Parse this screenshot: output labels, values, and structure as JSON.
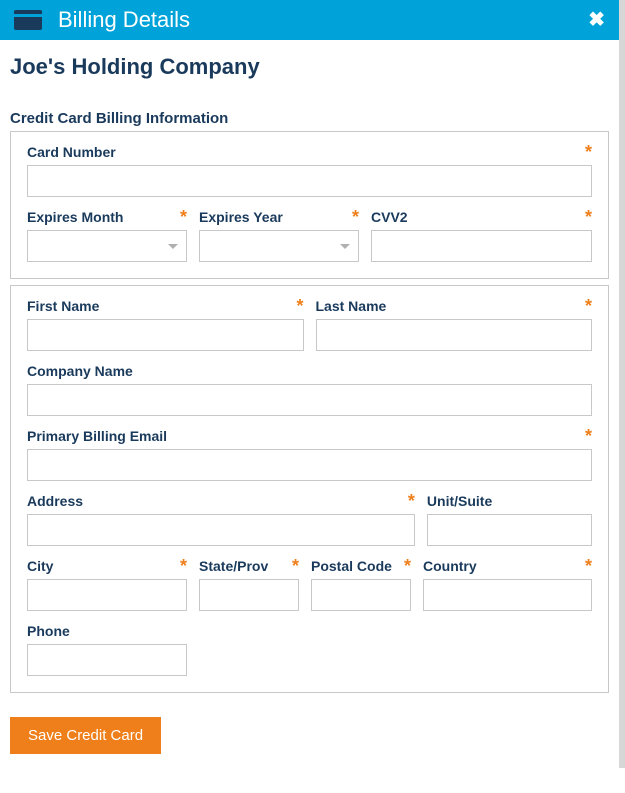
{
  "header": {
    "title": "Billing Details"
  },
  "company": "Joe's Holding Company",
  "section1": {
    "title": "Credit Card Billing Information",
    "card_number_label": "Card Number",
    "expires_month_label": "Expires Month",
    "expires_year_label": "Expires Year",
    "cvv2_label": "CVV2"
  },
  "section2": {
    "first_name_label": "First Name",
    "last_name_label": "Last Name",
    "company_name_label": "Company Name",
    "primary_email_label": "Primary Billing Email",
    "address_label": "Address",
    "unit_label": "Unit/Suite",
    "city_label": "City",
    "state_label": "State/Prov",
    "postal_label": "Postal Code",
    "country_label": "Country",
    "phone_label": "Phone"
  },
  "buttons": {
    "save": "Save Credit Card"
  }
}
